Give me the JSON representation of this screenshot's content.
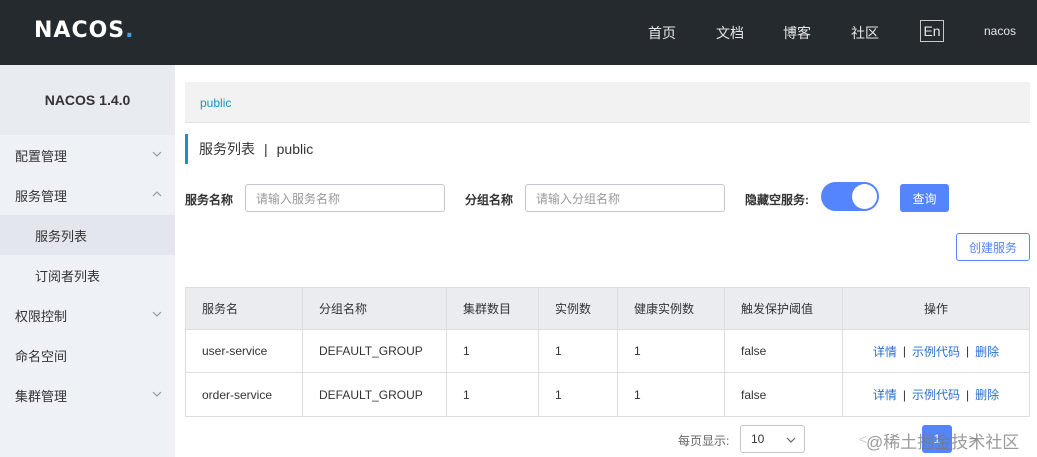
{
  "header": {
    "logo": "NACOS",
    "logo_dot": ".",
    "nav": [
      "首页",
      "文档",
      "博客",
      "社区"
    ],
    "lang": "En",
    "user": "nacos"
  },
  "sidebar": {
    "title": "NACOS 1.4.0",
    "items": [
      {
        "label": "配置管理",
        "chevron": "down"
      },
      {
        "label": "服务管理",
        "chevron": "up"
      },
      {
        "label": "服务列表"
      },
      {
        "label": "订阅者列表"
      },
      {
        "label": "权限控制",
        "chevron": "down"
      },
      {
        "label": "命名空间"
      },
      {
        "label": "集群管理",
        "chevron": "down"
      }
    ]
  },
  "breadcrumb": {
    "namespace": "public"
  },
  "page": {
    "title": "服务列表",
    "separator": "|",
    "namespace": "public"
  },
  "filters": {
    "service_name_label": "服务名称",
    "service_name_placeholder": "请输入服务名称",
    "group_name_label": "分组名称",
    "group_name_placeholder": "请输入分组名称",
    "hide_empty_label": "隐藏空服务:",
    "hide_empty_on": true,
    "query_button": "查询"
  },
  "create_button": "创建服务",
  "table": {
    "columns": [
      "服务名",
      "分组名称",
      "集群数目",
      "实例数",
      "健康实例数",
      "触发保护阈值",
      "操作"
    ],
    "rows": [
      [
        "user-service",
        "DEFAULT_GROUP",
        "1",
        "1",
        "1",
        "false"
      ],
      [
        "order-service",
        "DEFAULT_GROUP",
        "1",
        "1",
        "1",
        "false"
      ]
    ],
    "actions": {
      "detail": "详情",
      "sample_code": "示例代码",
      "delete": "删除",
      "separator": "|"
    }
  },
  "pagination": {
    "page_size_label": "每页显示:",
    "page_size": "10",
    "prev": "<",
    "current_page": "1",
    "next": ">"
  },
  "watermark": "@稀土掘金技术社区",
  "colors": {
    "header_bg": "#252a2f",
    "accent": "#5584ff",
    "link": "#2a6fc9",
    "sidebar_bg": "#eef1f6"
  }
}
